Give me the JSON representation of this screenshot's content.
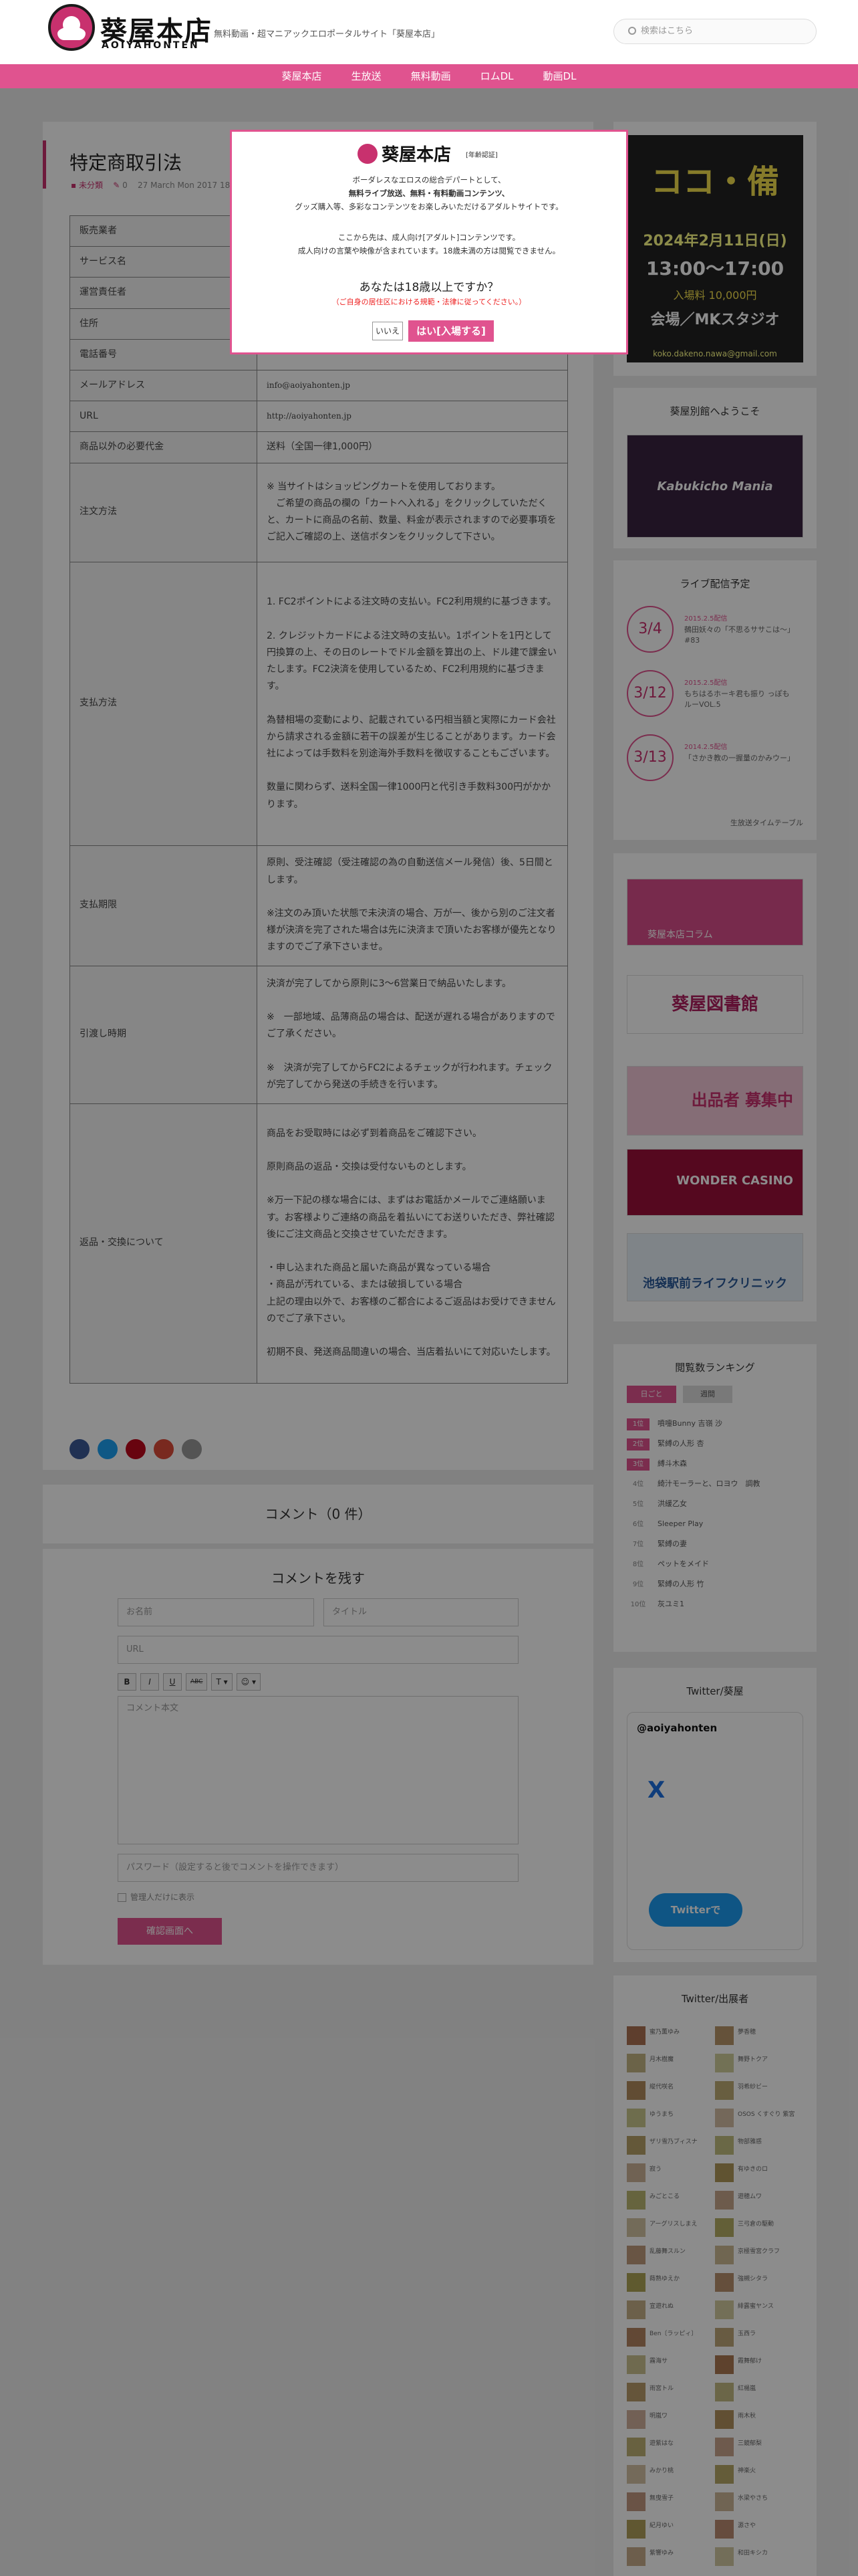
{
  "header": {
    "logo_main": "葵屋本店",
    "logo_sub": "AOIYAHONTEN",
    "tagline": "無料動画・超マニアックエロポータルサイト「葵屋本店」",
    "search_placeholder": "検索はこちら"
  },
  "nav": [
    "葵屋本店",
    "生放送",
    "無料動画",
    "ロムDL",
    "動画DL"
  ],
  "article": {
    "title": "特定商取引法",
    "category": "未分類",
    "comments": "0",
    "date": "27 March Mon 2017 18:"
  },
  "info_table": [
    {
      "k": "販売業者",
      "v": ""
    },
    {
      "k": "サービス名",
      "v": ""
    },
    {
      "k": "運営責任者",
      "v": ""
    },
    {
      "k": "住所",
      "v": ""
    },
    {
      "k": "電話番号",
      "v": ""
    },
    {
      "k": "メールアドレス",
      "v": "info@aoiyahonten.jp"
    },
    {
      "k": "URL",
      "v": "http://aoiyahonten.jp"
    },
    {
      "k": "商品以外の必要代金",
      "v": "送料（全国一律1,000円）"
    },
    {
      "k": "注文方法",
      "v": "※ 当サイトはショッピングカートを使用しております。\n　ご希望の商品の欄の「カートへ入れる」をクリックしていただくと、カートに商品の名前、数量、料金が表示されますので必要事項をご記入ご確認の上、送信ボタンをクリックして下さい。"
    },
    {
      "k": "支払方法",
      "v": "1. FC2ポイントによる注文時の支払い。FC2利用規約に基づきます。\n\n2. クレジットカードによる注文時の支払い。1ポイントを1円として円換算の上、その日のレートでドル金額を算出の上、ドル建で課金いたします。FC2決済を使用しているため、FC2利用規約に基づきます。\n\n為替相場の変動により、記載されている円相当額と実際にカード会社から請求される金額に若干の誤差が生じることがあります。カード会社によっては手数料を別途海外手数料を徴収することもございます。\n\n数量に関わらず、送料全国一律1000円と代引き手数料300円がかかります。"
    },
    {
      "k": "支払期限",
      "v": "原則、受注確認（受注確認の為の自動送信メール発信）後、5日間とします。\n\n※注文のみ頂いた状態で未決済の場合、万が一、後から別のご注文者様が決済を完了された場合は先に決済まで頂いたお客様が優先となりますのでご了承下さいませ。"
    },
    {
      "k": "引渡し時期",
      "v": "決済が完了してから原則に3〜6営業日で納品いたします。\n\n※　一部地域、品薄商品の場合は、配送が遅れる場合がありますのでご了承ください。\n\n※　決済が完了してからFC2によるチェックが行われます。チェックが完了してから発送の手続きを行います。"
    },
    {
      "k": "返品・交換について",
      "v": "商品をお受取時には必ず到着商品をご確認下さい。\n\n原則商品の返品・交換は受付ないものとします。\n\n※万一下記の様な場合には、まずはお電話かメールでご連絡願います。お客様よりご連絡の商品を着払いにてお送りいただき、弊社確認後にご注文商品と交換させていただきます。\n\n・申し込まれた商品と届いた商品が異なっている場合\n・商品が汚れている、または破損している場合\n上記の理由以外で、お客様のご都合によるご返品はお受けできませんのでご了承下さい。\n\n初期不良、発送商品間違いの場合、当店着払いにて対応いたします。"
    }
  ],
  "comments": {
    "count_label": "コメント（0 件）"
  },
  "comment_form": {
    "title": "コメントを残す",
    "name_placeholder": "お名前",
    "title_placeholder": "タイトル",
    "url_placeholder": "URL",
    "body_placeholder": "コメント本文",
    "password_placeholder": "パスワード（設定すると後でコメントを操作できます）",
    "private_label": "管理人だけに表示",
    "submit_label": "確認画面へ",
    "toolbar": [
      "B",
      "I",
      "U",
      "ABC",
      "T ▾",
      "☺ ▾"
    ]
  },
  "sidebar": {
    "event_banner": {
      "title": "ココ・備",
      "date": "2024年2月11日(日)",
      "time": "13:00～17:00",
      "price": "入場料 10,000円",
      "venue": "会場／MKスタジオ",
      "email": "koko.dakeno.nawa@gmail.com"
    },
    "welcome_title": "葵屋別館へようこそ",
    "welcome_banner": "Kabukicho Mania",
    "live_title": "ライブ配信予定",
    "live": [
      {
        "date": "3/4",
        "meta": "2015.2.5配信",
        "text": "鵺田妖々の「不思るササこは〜」#83"
      },
      {
        "date": "3/12",
        "meta": "2015.2.5配信",
        "text": "もちはるホーキ君も振り っぽも ルーVOL.5"
      },
      {
        "date": "3/13",
        "meta": "2014.2.5配信",
        "text": "「さかき教の一握量のかみウー」"
      }
    ],
    "live_link": "生放送タイムテーブル",
    "banners": [
      "葵屋本店コラム",
      "葵屋図書館",
      "出品者 募集中",
      "WONDER CASINO",
      "池袋駅前ライフクリニック"
    ],
    "ranking_title": "閲覧数ランキング",
    "ranking_tabs": [
      "日ごと",
      "週間"
    ],
    "ranking": [
      "噴嚏Bunny 吉嶺 沙",
      "緊縛の人形 杏",
      "縛斗木森",
      "綺汁モーラーと、ロヨウ　調教",
      "洪緩乙女",
      "Sleeper Play",
      "緊縛の妻",
      "ペットをメイド",
      "緊縛の人形 竹",
      "灰ユミ1"
    ],
    "twitter_title": "Twitter/葵屋",
    "twitter_handle": "@aoiyahonten",
    "twitter_follow": "Twitterで",
    "performers_title": "Twitter/出展者",
    "performers": [
      "蜜乃薫ゆみ",
      "夢香穂",
      "月木樹魔",
      "舞野トクア",
      "縦代咲名",
      "羽希紗ビー",
      "ゆうまち",
      "OSOS くすぐり 紫宮",
      "ザリ雪乃ブィスナ",
      "物部雅惑",
      "寂う",
      "有ゆきのロ",
      "みごとこる",
      "遊穂ムワ",
      "アーグリスしまえ",
      "三弓倉の駆動",
      "乱藤舞スルン",
      "京極雪宮クラフ",
      "蒔熟ゆえか",
      "強槻シタラ",
      "宣遊れぬ",
      "緋露蜜ヤンス",
      "Ben〔ラッピィ〕",
      "玉西ラ",
      "霧海サ",
      "霞舞郁け",
      "雨宮トル",
      "紅楊嵐",
      "明嵐ワ",
      "雨木秋",
      "遊紫はな",
      "三鏡郁梨",
      "みかり桃",
      "神楽火",
      "無曳雪子",
      "水梁やさち",
      "紀月ゆい",
      "源さや",
      "紫響ゆみ",
      "和田キシカ"
    ]
  },
  "modal": {
    "logo": "葵屋本店",
    "badge": "[年齢認証]",
    "lines": [
      "ボーダレスなエロスの総合デパートとして、",
      "無料ライブ放送、無料・有料動画コンテンツ、",
      "グッズ購入等、多彩なコンテンツをお楽しみいただけるアダルトサイトです。",
      "",
      "ここから先は、成人向け[アダルト]コンテンツです。",
      "成人向けの言葉や映像が含まれています。18歳未満の方は閲覧できません。"
    ],
    "question": "あなたは18歳以上ですか？",
    "warning": "（ご自身の居住区における規範・法律に従ってください。）",
    "no": "いいえ",
    "yes": "はい[入場する]"
  },
  "colors": {
    "accent": "#e0538f",
    "brand": "#c8316e"
  }
}
